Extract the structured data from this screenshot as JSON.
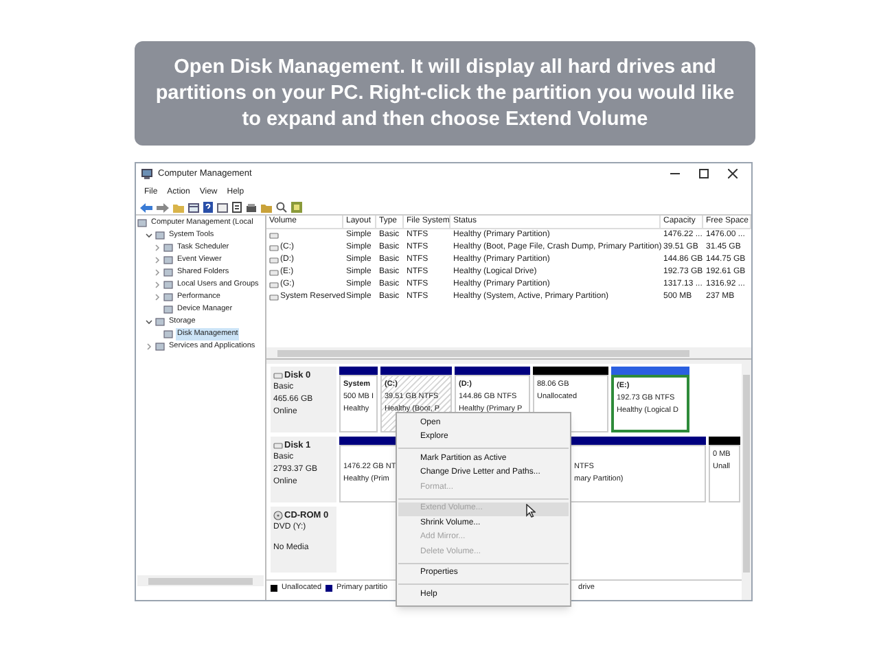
{
  "banner": {
    "text": "Open Disk Management. It will display all hard drives and partitions on your PC. Right-click the partition you would like to expand and then choose Extend Volume"
  },
  "window": {
    "title": "Computer Management"
  },
  "menu_bar": [
    "File",
    "Action",
    "View",
    "Help"
  ],
  "tree": [
    {
      "label": "Computer Management (Local",
      "selected": false,
      "children": [
        {
          "label": "System Tools",
          "expanded": true,
          "selected": false,
          "children": [
            {
              "label": "Task Scheduler",
              "expanded": false,
              "selected": false
            },
            {
              "label": "Event Viewer",
              "expanded": false,
              "selected": false
            },
            {
              "label": "Shared Folders",
              "expanded": false,
              "selected": false
            },
            {
              "label": "Local Users and Groups",
              "expanded": false,
              "selected": false
            },
            {
              "label": "Performance",
              "expanded": false,
              "selected": false
            },
            {
              "label": "Device Manager",
              "selected": false
            }
          ]
        },
        {
          "label": "Storage",
          "expanded": true,
          "selected": false,
          "children": [
            {
              "label": "Disk Management",
              "selected": true
            }
          ]
        },
        {
          "label": "Services and Applications",
          "expanded": false,
          "selected": false
        }
      ]
    }
  ],
  "table": {
    "columns": [
      "Volume",
      "Layout",
      "Type",
      "File System",
      "Status",
      "Capacity",
      "Free Space"
    ],
    "rows": [
      [
        "",
        "Simple",
        "Basic",
        "NTFS",
        "Healthy (Primary Partition)",
        "1476.22 ...",
        "1476.00 ..."
      ],
      [
        "(C:)",
        "Simple",
        "Basic",
        "NTFS",
        "Healthy (Boot, Page File, Crash Dump, Primary Partition)",
        "39.51 GB",
        "31.45 GB"
      ],
      [
        "(D:)",
        "Simple",
        "Basic",
        "NTFS",
        "Healthy (Primary Partition)",
        "144.86 GB",
        "144.75 GB"
      ],
      [
        "(E:)",
        "Simple",
        "Basic",
        "NTFS",
        "Healthy (Logical Drive)",
        "192.73 GB",
        "192.61 GB"
      ],
      [
        "(G:)",
        "Simple",
        "Basic",
        "NTFS",
        "Healthy (Primary Partition)",
        "1317.13 ...",
        "1316.92 ..."
      ],
      [
        "System Reserved",
        "Simple",
        "Basic",
        "NTFS",
        "Healthy (System, Active, Primary Partition)",
        "500 MB",
        "237 MB"
      ]
    ]
  },
  "disks": [
    {
      "name": "Disk 0",
      "kind": "disk",
      "lines": [
        "Basic",
        "465.66 GB",
        "Online"
      ],
      "partitions": [
        {
          "kind": "primary",
          "name": "System",
          "lines": [
            "500 MB I",
            "Healthy"
          ],
          "selected": false,
          "focused": false
        },
        {
          "kind": "primary",
          "name": "(C:)",
          "lines": [
            "39.51 GB NTFS",
            "Healthy (Boot, P"
          ],
          "selected": true,
          "focused": false
        },
        {
          "kind": "primary",
          "name": "(D:)",
          "lines": [
            "144.86 GB NTFS",
            "Healthy (Primary P"
          ],
          "selected": false,
          "focused": false
        },
        {
          "kind": "unallocated",
          "lines": [
            "88.06 GB",
            "Unallocated"
          ],
          "selected": false,
          "focused": false
        },
        {
          "kind": "logical",
          "name": "(E:)",
          "lines": [
            "192.73 GB NTFS",
            "Healthy (Logical D"
          ],
          "selected": false,
          "focused": true
        }
      ]
    },
    {
      "name": "Disk 1",
      "kind": "disk",
      "lines": [
        "Basic",
        "2793.37 GB",
        "Online"
      ],
      "partitions": [
        {
          "kind": "primary",
          "lines": [
            "1476.22 GB NT",
            "Healthy (Prim"
          ],
          "selected": false,
          "focused": false
        },
        {
          "kind": "primary",
          "lines": [
            "NTFS",
            "mary Partition)"
          ],
          "selected": false,
          "focused": false
        },
        {
          "kind": "unallocated",
          "lines": [
            "0 MB",
            "Unall"
          ],
          "selected": false,
          "focused": false
        }
      ]
    },
    {
      "name": "CD-ROM 0",
      "kind": "cdrom",
      "lines": [
        "DVD (Y:)",
        "No Media"
      ]
    }
  ],
  "legend": [
    {
      "label": "Unallocated",
      "color": "#000000"
    },
    {
      "label": "Primary partitio",
      "color": "#00007f"
    }
  ],
  "legend_tail": "drive",
  "context_menu": [
    {
      "kind": "item",
      "label": "Open",
      "disabled": false,
      "hovered": false
    },
    {
      "kind": "item",
      "label": "Explore",
      "disabled": false,
      "hovered": false
    },
    {
      "kind": "separator"
    },
    {
      "kind": "item",
      "label": "Mark Partition as Active",
      "disabled": false,
      "hovered": false
    },
    {
      "kind": "item",
      "label": "Change Drive Letter and Paths...",
      "disabled": false,
      "hovered": false
    },
    {
      "kind": "item",
      "label": "Format...",
      "disabled": true,
      "hovered": false
    },
    {
      "kind": "separator"
    },
    {
      "kind": "item",
      "label": "Extend Volume...",
      "disabled": true,
      "hovered": true
    },
    {
      "kind": "item",
      "label": "Shrink Volume...",
      "disabled": false,
      "hovered": false
    },
    {
      "kind": "item",
      "label": "Add Mirror...",
      "disabled": true,
      "hovered": false
    },
    {
      "kind": "item",
      "label": "Delete Volume...",
      "disabled": true,
      "hovered": false
    },
    {
      "kind": "separator"
    },
    {
      "kind": "item",
      "label": "Properties",
      "disabled": false,
      "hovered": false
    },
    {
      "kind": "separator"
    },
    {
      "kind": "item",
      "label": "Help",
      "disabled": false,
      "hovered": false
    }
  ]
}
